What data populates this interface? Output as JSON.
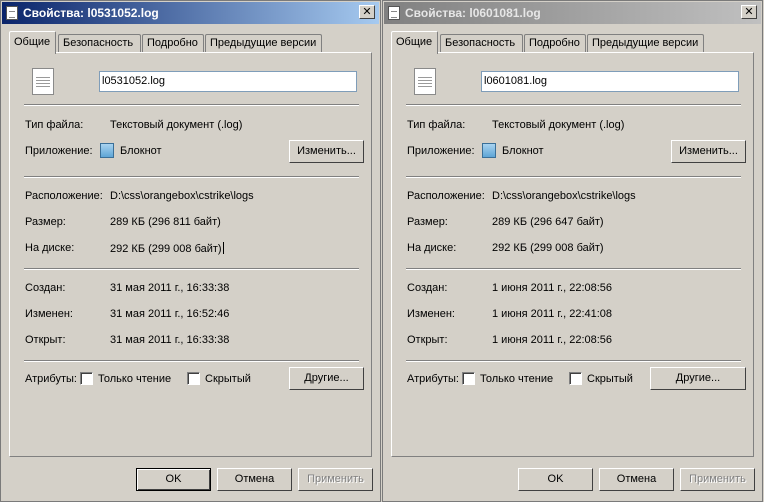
{
  "tabs": [
    "Общие",
    "Безопасность",
    "Подробно",
    "Предыдущие версии"
  ],
  "labels": {
    "file_type": "Тип файла:",
    "application": "Приложение:",
    "location": "Расположение:",
    "size": "Размер:",
    "on_disk": "На диске:",
    "created": "Создан:",
    "modified": "Изменен:",
    "accessed": "Открыт:",
    "attributes": "Атрибуты:",
    "readonly": "Только чтение",
    "hidden": "Скрытый"
  },
  "buttons": {
    "change": "Изменить...",
    "advanced": "Другие...",
    "ok": "OK",
    "cancel": "Отмена",
    "apply": "Применить"
  },
  "windows": [
    {
      "title": "Свойства: l0531052.log",
      "filename": "l0531052.log",
      "file_type": "Текстовый документ (.log)",
      "application": "Блокнот",
      "location": "D:\\css\\orangebox\\cstrike\\logs",
      "size": "289 КБ (296 811 байт)",
      "on_disk": "292 КБ (299 008 байт)",
      "created": "31 мая 2011 г., 16:33:38",
      "modified": "31 мая 2011 г., 16:52:46",
      "accessed": "31 мая 2011 г., 16:33:38",
      "active": true
    },
    {
      "title": "Свойства: l0601081.log",
      "filename": "l0601081.log",
      "file_type": "Текстовый документ (.log)",
      "application": "Блокнот",
      "location": "D:\\css\\orangebox\\cstrike\\logs",
      "size": "289 КБ (296 647 байт)",
      "on_disk": "292 КБ (299 008 байт)",
      "created": "1 июня 2011 г., 22:08:56",
      "modified": "1 июня 2011 г., 22:41:08",
      "accessed": "1 июня 2011 г., 22:08:56",
      "active": false
    }
  ],
  "icons": {
    "title": "document-icon",
    "file": "text-file-icon",
    "app": "notepad-icon",
    "close": "close-icon"
  },
  "colors": {
    "active_title_start": "#0a246a",
    "active_title_end": "#a6caf0",
    "inactive_title_start": "#808080",
    "inactive_title_end": "#c0c0c0",
    "face": "#d4d0c8"
  }
}
